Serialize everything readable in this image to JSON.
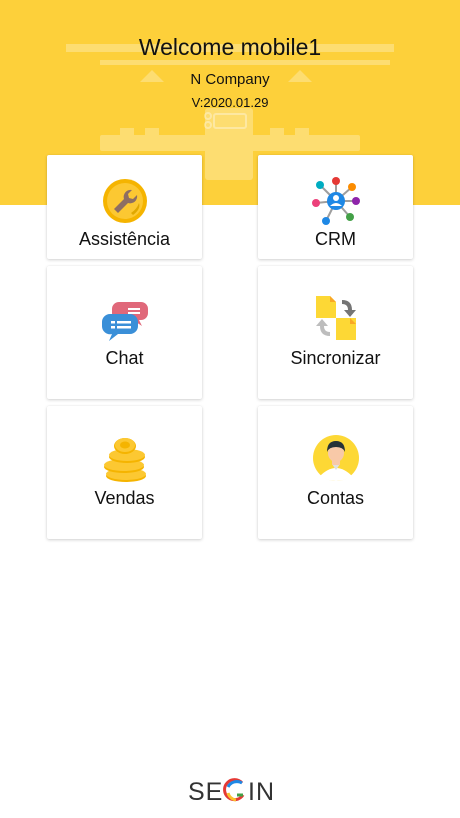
{
  "header": {
    "title": "Welcome mobile1",
    "company": "N Company",
    "version": "V:2020.01.29"
  },
  "menu": [
    {
      "label": "Assistência",
      "icon": "wrench-coin-icon"
    },
    {
      "label": "CRM",
      "icon": "network-hub-icon"
    },
    {
      "label": "Chat",
      "icon": "chat-bubbles-icon"
    },
    {
      "label": "Sincronizar",
      "icon": "sync-files-icon"
    },
    {
      "label": "Vendas",
      "icon": "coin-stack-icon"
    },
    {
      "label": "Contas",
      "icon": "user-avatar-icon"
    }
  ],
  "footer": {
    "logo_text": "SEGIN"
  },
  "colors": {
    "banner": "#fdd03a",
    "accent_gold": "#f5b400",
    "chat_pink": "#e0687a",
    "chat_blue": "#3a8fd8"
  }
}
